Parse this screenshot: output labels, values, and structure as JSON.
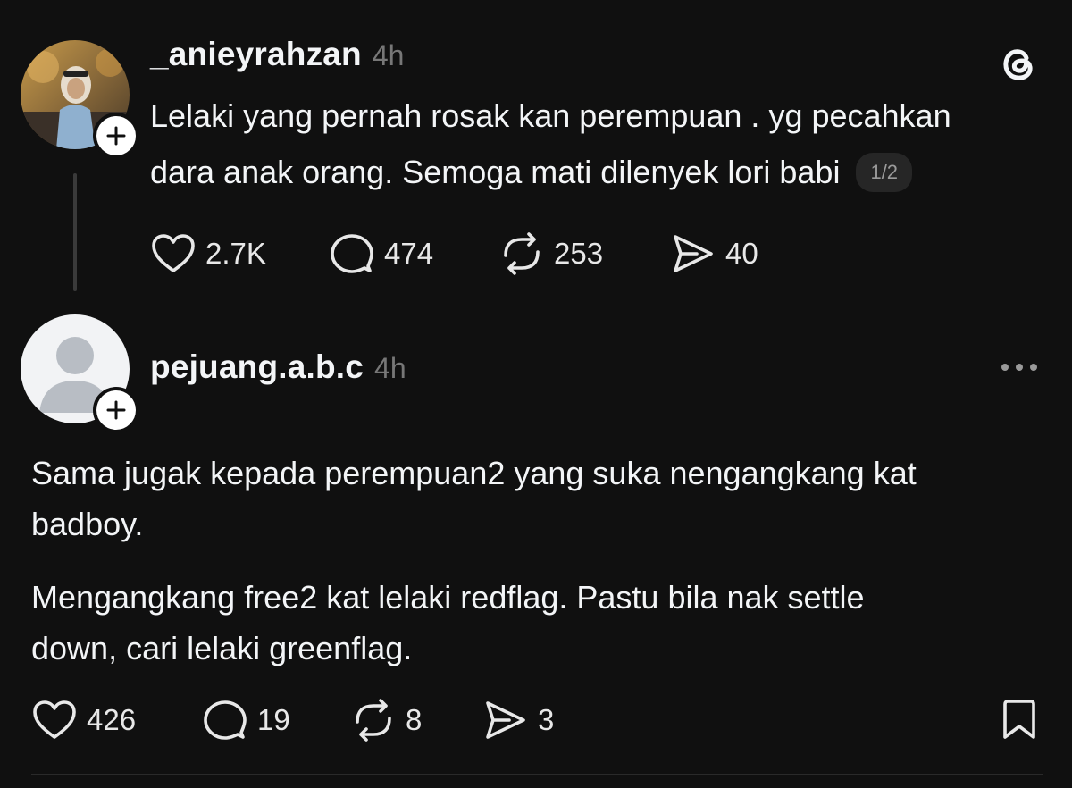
{
  "post_1": {
    "username": "_anieyrahzan",
    "time": "4h",
    "text_line_1": "Lelaki yang pernah rosak kan perempuan . yg pecahkan",
    "text_line_2": "dara anak orang. Semoga mati dilenyek lori babi",
    "page_indicator": "1/2",
    "likes": "2.7K",
    "replies": "474",
    "reposts": "253",
    "shares": "40",
    "app_icon": "threads-logo-icon"
  },
  "post_2": {
    "username": "pejuang.a.b.c",
    "time": "4h",
    "paragraph_1_line_1": "Sama jugak kepada perempuan2 yang suka nengangkang kat",
    "paragraph_1_line_2": "badboy.",
    "paragraph_2_line_1": "Mengangkang free2 kat lelaki redflag. Pastu bila nak settle",
    "paragraph_2_line_2": "down, cari lelaki greenflag.",
    "likes": "426",
    "replies": "19",
    "reposts": "8",
    "shares": "3",
    "more_icon": "more-options-icon",
    "save_icon": "bookmark-icon"
  },
  "colors": {
    "background": "#101010",
    "text_primary": "#f3f5f7",
    "text_secondary": "#777777",
    "divider": "#2a2a2a"
  }
}
